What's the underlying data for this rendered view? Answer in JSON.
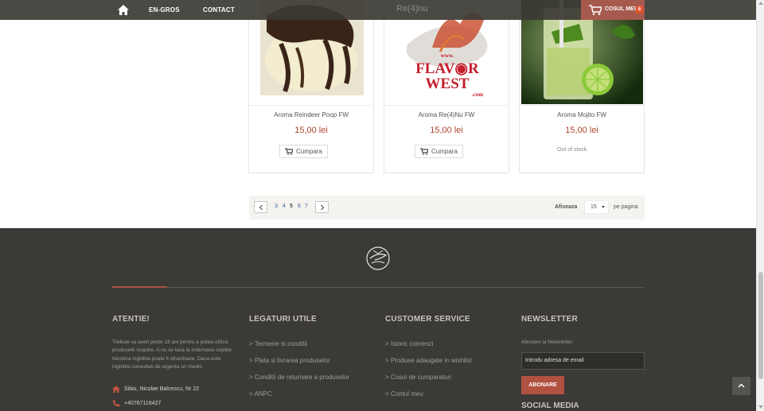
{
  "nav": {
    "links": [
      "EN-GROS",
      "CONTACT"
    ],
    "brand": "Re(4)nu",
    "cart_label": "COSUL MEU",
    "cart_count": "6"
  },
  "products": [
    {
      "name": "Aroma Reindeer Poop FW",
      "price": "15,00 lei",
      "action": "Cumpara",
      "in_stock": true
    },
    {
      "name": "Aroma Re(4)Nu FW",
      "price": "15,00 lei",
      "action": "Cumpara",
      "in_stock": true,
      "image_text": "FLAVOR WEST .com"
    },
    {
      "name": "Aroma Mojito FW",
      "price": "15,00 lei",
      "stock_label": "Out of stock",
      "in_stock": false
    }
  ],
  "pagination": {
    "pages": [
      "3",
      "4",
      "5",
      "6",
      "7"
    ],
    "current_page": "5",
    "show_label": "Afiseaza",
    "per_page_value": "15",
    "per_page_suffix": "pe pagina"
  },
  "footer": {
    "col1": {
      "title": "ATENTIE!",
      "text": "Trebuie sa aveti peste 18 ani pentru a putea utiliza produsele noastre. A nu se lasa la indemana copiilor. Nicotina inghitita poate fi otravitoare. Daca este inghitita consultati de urgenta un medic.",
      "address": "Sibiu, Nicolae Balcescu, Nr 22",
      "phone": "+40767116427"
    },
    "col2": {
      "title": "LEGATURI UTILE",
      "links": [
        "> Termene si conditii",
        "> Plata si livrarea produselor",
        "> Conditii de returnare a produselor",
        "> ANPC"
      ]
    },
    "col3": {
      "title": "CUSTOMER SERVICE",
      "links": [
        "> Istoric comenzi",
        "> Produse adaugate in wishlist",
        "> Cosul de cumparaturi",
        "> Contul meu"
      ]
    },
    "col4": {
      "title": "NEWSLETTER",
      "label": "Abonare la Newsletter:",
      "placeholder": "Introdu adresa de email",
      "button": "ABONARE",
      "social_title": "SOCIAL MEDIA"
    }
  },
  "colors": {
    "accent": "#b1513f",
    "price": "#b0452f",
    "footer_bg": "#3b3a37",
    "nav_bg": "#3c3a34"
  }
}
